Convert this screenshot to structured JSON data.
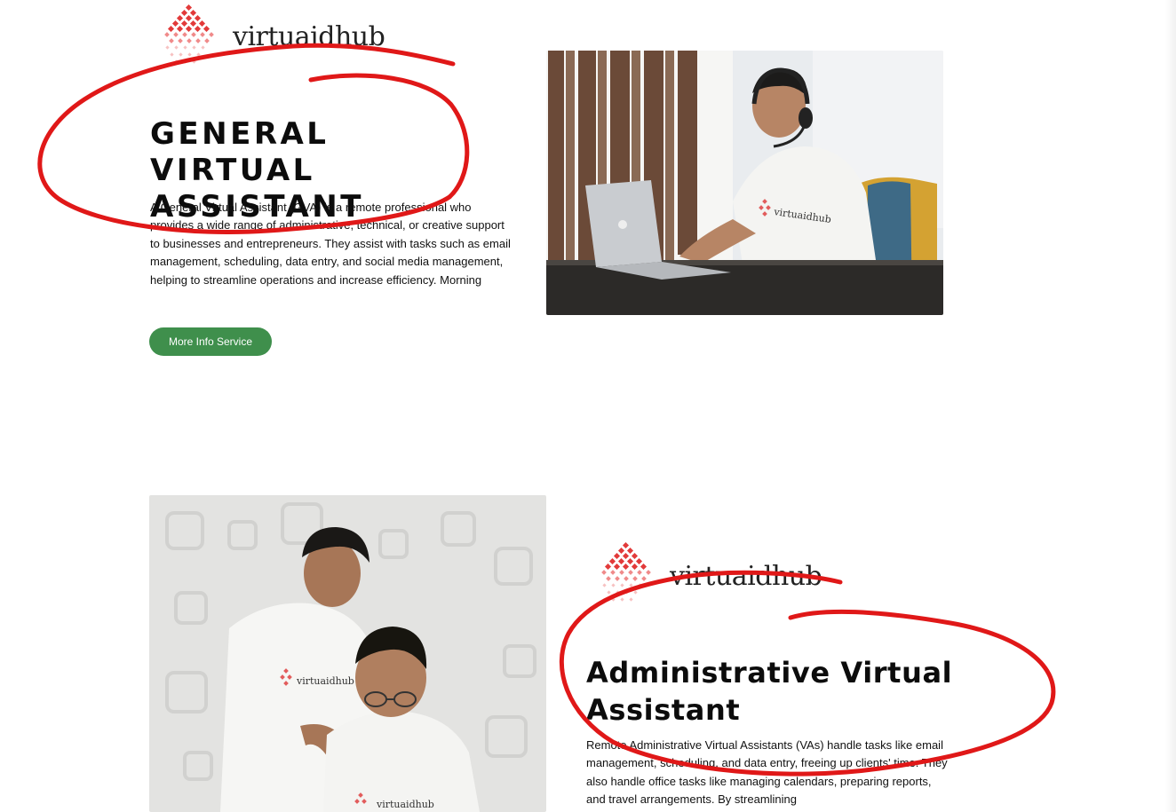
{
  "brand": {
    "name": "virtuaidhub",
    "accent_color": "#e23a3a"
  },
  "section1": {
    "title": "GENERAL VIRTUAL ASSISTANT",
    "description": "A General Virtual Assistant (GVA) is a remote professional who provides a wide range of administrative, technical, or creative support to businesses and entrepreneurs. They assist with tasks such as email management, scheduling, data entry, and social media management, helping to streamline operations and increase efficiency. Morning",
    "button_label": "More Info Service",
    "button_color": "#3f8f4c",
    "image": {
      "shirt_logo_text": "virtuaidhub"
    }
  },
  "section2": {
    "title": "Administrative Virtual Assistant",
    "description": "Remote Administrative Virtual Assistants (VAs) handle tasks like email management, scheduling, and data entry, freeing up clients' time. They also handle office tasks like managing calendars, preparing reports, and travel arrangements. By streamlining",
    "image": {
      "shirt_logo_text_1": "virtuaidhub",
      "shirt_logo_text_2": "virtuaidhub"
    }
  },
  "annotation": {
    "color": "#e01818"
  }
}
